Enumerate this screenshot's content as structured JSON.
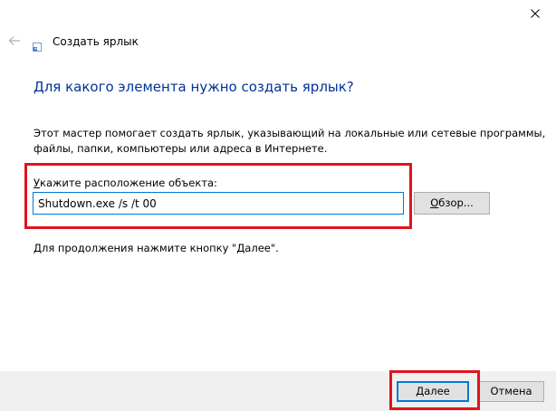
{
  "window": {
    "title": "Создать ярлык",
    "close_icon": "close-icon",
    "back_icon": "back-arrow-icon",
    "wizard_icon": "shortcut-icon"
  },
  "content": {
    "heading": "Для какого элемента нужно создать ярлык?",
    "description_line1": "Этот мастер помогает создать ярлык, указывающий на локальные или сетевые программы,",
    "description_line2": "файлы, папки, компьютеры или адреса в Интернете.",
    "location_label_accel": "У",
    "location_label_rest": "кажите расположение объекта:",
    "location_value": "Shutdown.exe /s /t 00",
    "browse_accel": "О",
    "browse_rest": "бзор...",
    "continue_hint": "Для продолжения нажмите кнопку \"Далее\"."
  },
  "footer": {
    "next_accel": "Д",
    "next_rest": "алее",
    "cancel_label": "Отмена"
  },
  "colors": {
    "heading": "#003399",
    "highlight": "#e0141e",
    "focus_border": "#0078d7",
    "footer_bg": "#f0f0f0",
    "button_bg": "#e1e1e1"
  }
}
